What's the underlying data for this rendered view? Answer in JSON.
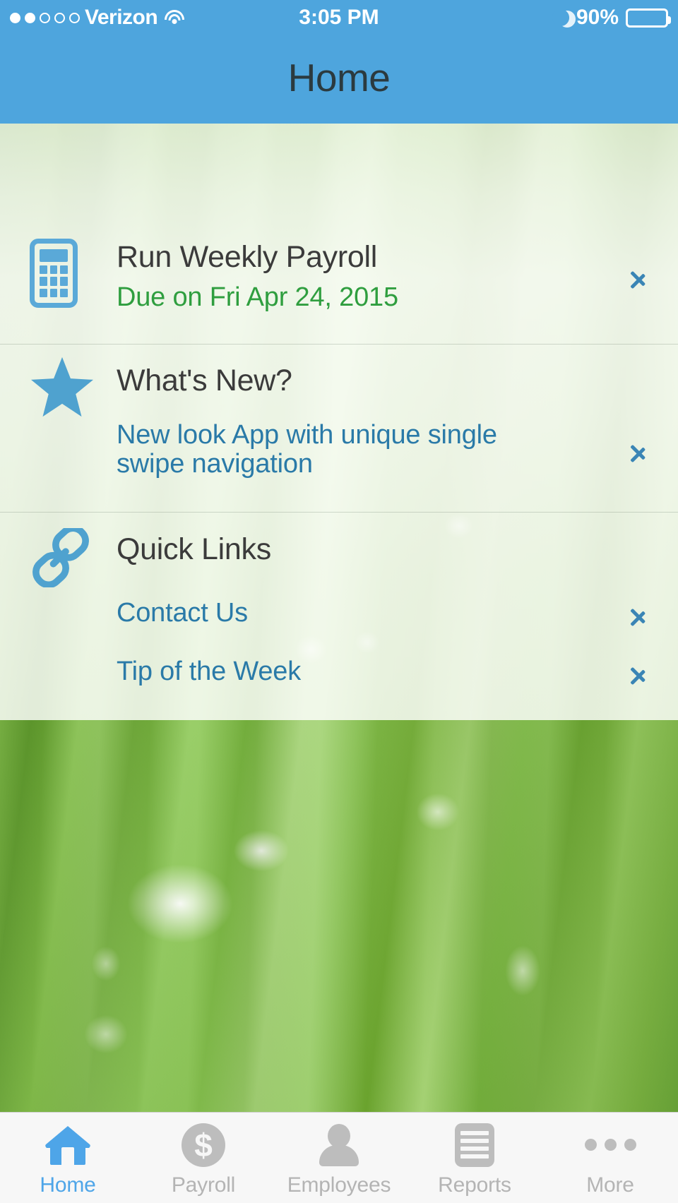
{
  "status_bar": {
    "signal_dots_total": 5,
    "signal_dots_filled": 2,
    "carrier": "Verizon",
    "wifi_icon": "wifi-icon",
    "time": "3:05 PM",
    "moon_icon": "moon-icon",
    "battery_percent": "90%",
    "battery_level": 90
  },
  "nav": {
    "title": "Home"
  },
  "rows": [
    {
      "id": "run-weekly-payroll",
      "icon": "calculator-icon",
      "title": "Run Weekly Payroll",
      "subtitle": "Due on Fri Apr 24, 2015",
      "chevron": "chevron-right-icon"
    },
    {
      "id": "whats-new",
      "icon": "star-icon",
      "title": "What's New?",
      "link": "New look App with unique single swipe navigation",
      "chevron": "chevron-right-icon"
    },
    {
      "id": "quick-links",
      "icon": "link-chain-icon",
      "title": "Quick Links",
      "links": [
        {
          "label": "Contact Us",
          "chevron": "chevron-right-icon"
        },
        {
          "label": "Tip of the Week",
          "chevron": "chevron-right-icon"
        }
      ]
    }
  ],
  "tabs": [
    {
      "label": "Home",
      "icon": "home-icon",
      "active": true
    },
    {
      "label": "Payroll",
      "icon": "dollar-circle-icon",
      "active": false
    },
    {
      "label": "Employees",
      "icon": "person-icon",
      "active": false
    },
    {
      "label": "Reports",
      "icon": "document-icon",
      "active": false
    },
    {
      "label": "More",
      "icon": "ellipsis-icon",
      "active": false
    }
  ],
  "colors": {
    "header_blue": "#4ea5dd",
    "accent_blue": "#4ea5e8",
    "link_blue": "#2a7aa8",
    "due_green": "#2f9e3f",
    "title_gray": "#3b3b3b",
    "tab_inactive_gray": "#b4b4b4"
  }
}
